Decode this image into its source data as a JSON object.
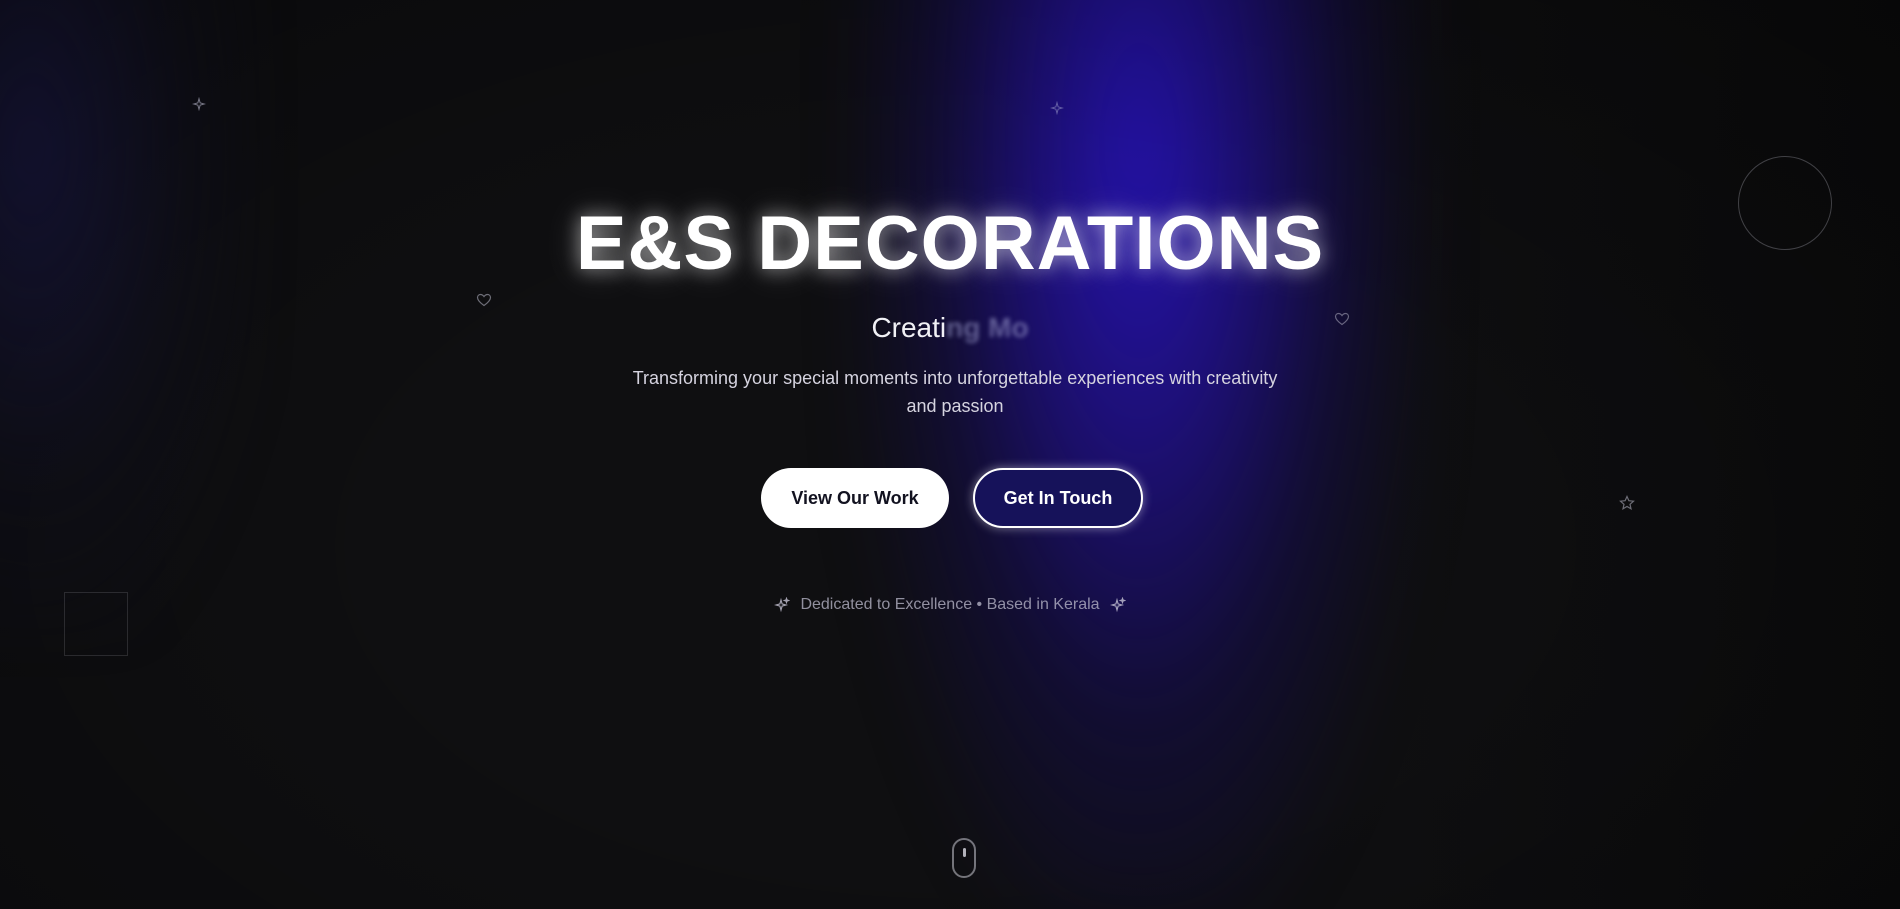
{
  "hero": {
    "title": "E&S DECORATIONS",
    "typing_visible": "Creati",
    "typing_faded": "ng Mo",
    "subtitle": "Transforming your special moments into unforgettable experiences with creativity and passion",
    "primary_button": "View Our Work",
    "secondary_button": "Get In Touch",
    "tagline": "Dedicated to Excellence • Based in Kerala"
  },
  "colors": {
    "background": "#0f0f11",
    "glow": "#2a14be",
    "title": "#ffffff",
    "secondary_button_bg": "#16125a"
  },
  "icons": {
    "decorations": [
      "sparkles-icon",
      "heart-icon",
      "star-icon",
      "circle-outline",
      "square-outline"
    ],
    "scroll": "mouse-scroll-icon"
  }
}
